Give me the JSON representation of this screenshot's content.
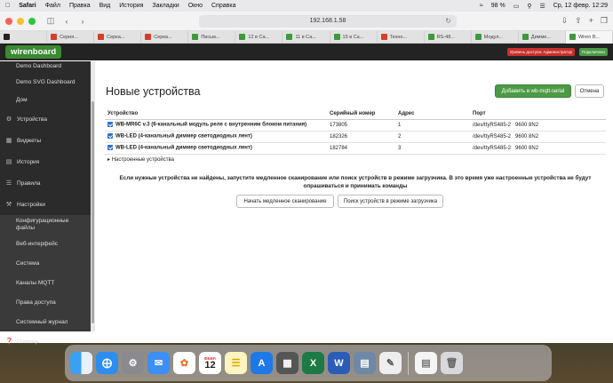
{
  "menubar": {
    "apple": "",
    "items": [
      "Safari",
      "Файл",
      "Правка",
      "Вид",
      "История",
      "Закладки",
      "Окно",
      "Справка"
    ],
    "battery": "98 %",
    "datetime": "Ср, 12 февр.  12:29"
  },
  "browser": {
    "url": "192.168.1.58",
    "tabs": [
      {
        "label": "Серия...",
        "color": "#d43f2a"
      },
      {
        "label": "Серка...",
        "color": "#d43f2a"
      },
      {
        "label": "Серка...",
        "color": "#d43f2a"
      },
      {
        "label": "Письм...",
        "color": "#3d9a3d"
      },
      {
        "label": "12 в Са...",
        "color": "#3d9a3d"
      },
      {
        "label": "11 в Са...",
        "color": "#3d9a3d"
      },
      {
        "label": "15 в Са...",
        "color": "#3d9a3d"
      },
      {
        "label": "Техно...",
        "color": "#d43f2a"
      },
      {
        "label": "RS-48...",
        "color": "#3d9a3d"
      },
      {
        "label": "Модул...",
        "color": "#3d9a3d"
      },
      {
        "label": "Димме...",
        "color": "#3d9a3d"
      },
      {
        "label": "Wiren B...",
        "color": "#3d9a3d"
      }
    ]
  },
  "header": {
    "logo": "wirenboard",
    "access_level": "Уровень доступа: Администратор",
    "status": "Подключено"
  },
  "sidebar": {
    "items": [
      {
        "label": "Demo Dashboard",
        "icon": "",
        "sub": true
      },
      {
        "label": "Demo SVG Dashboard",
        "icon": "",
        "sub": true
      },
      {
        "label": "Дом",
        "icon": "",
        "sub": true
      },
      {
        "label": "Устройства",
        "icon": "gear-icon",
        "sub": false
      },
      {
        "label": "Виджеты",
        "icon": "grid-icon",
        "sub": false
      },
      {
        "label": "История",
        "icon": "chart-icon",
        "sub": false
      },
      {
        "label": "Правила",
        "icon": "rules-icon",
        "sub": false
      },
      {
        "label": "Настройки",
        "icon": "wrench-icon",
        "sub": false
      },
      {
        "label": "Конфигурационные файлы",
        "icon": "",
        "sub": true
      },
      {
        "label": "Веб-интерфейс",
        "icon": "",
        "sub": true
      },
      {
        "label": "Система",
        "icon": "",
        "sub": true
      },
      {
        "label": "Каналы MQTT",
        "icon": "",
        "sub": true
      },
      {
        "label": "Права доступа",
        "icon": "",
        "sub": true
      },
      {
        "label": "Системный журнал",
        "icon": "",
        "sub": true
      },
      {
        "label": "Помощь",
        "icon": "help-icon",
        "sub": false
      }
    ]
  },
  "main": {
    "title": "Новые устройства",
    "add_button": "Добавить в wb-mqtt-serial",
    "cancel_button": "Отмена",
    "table": {
      "headers": [
        "Устройство",
        "Серийный номер",
        "Адрес",
        "Порт"
      ],
      "rows": [
        {
          "device": "WB-MR6C v.3 (6-канальный модуль реле с внутренним блоком питания)",
          "serial": "173805",
          "address": "1",
          "port": "/dev/ttyRS485-2",
          "params": "9600 8N2"
        },
        {
          "device": "WB-LED (4-канальный диммер светодиодных лент)",
          "serial": "182326",
          "address": "2",
          "port": "/dev/ttyRS485-2",
          "params": "9600 8N2"
        },
        {
          "device": "WB-LED (4-канальный диммер светодиодных лент)",
          "serial": "182784",
          "address": "3",
          "port": "/dev/ttyRS485-2",
          "params": "9600 8N2"
        }
      ]
    },
    "configured_toggle": "Настроенные устройства",
    "notice_line1": "Если нужные устройства не найдены, запустите медленное сканирование или поиск устройств в режиме загрузчика. В это время уже настроенные устройства не будут",
    "notice_line2": "опрашиваться и принимать команды",
    "slow_scan_button": "Начать медленное сканирование",
    "bootloader_button": "Поиск устройств в режиме загрузчика"
  },
  "dock": {
    "calendar_month": "ФЕВР.",
    "calendar_day": "12"
  }
}
